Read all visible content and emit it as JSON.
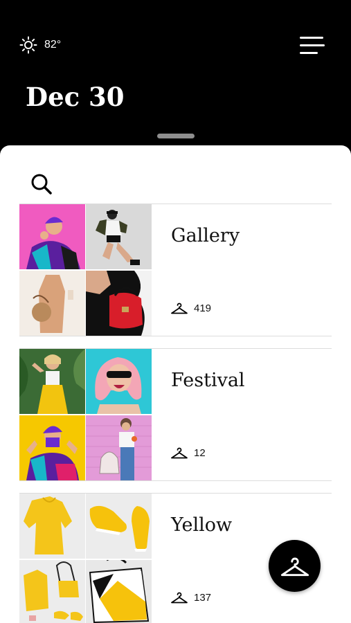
{
  "header": {
    "weather": {
      "icon": "sun-icon",
      "temperature": "82°"
    },
    "date": "Dec 30",
    "menu_icon": "hamburger-menu-icon"
  },
  "search": {
    "icon": "search-icon"
  },
  "collections": [
    {
      "title": "Gallery",
      "count": "419",
      "count_icon": "hanger-icon",
      "tile_colors": [
        "#f05bc0",
        "#d9d9d9",
        "#f3ede6",
        "#101010"
      ]
    },
    {
      "title": "Festival",
      "count": "12",
      "count_icon": "hanger-icon",
      "tile_colors": [
        "#3b6b35",
        "#2ec7d6",
        "#f6c800",
        "#e39bd8"
      ]
    },
    {
      "title": "Yellow",
      "count": "137",
      "count_icon": "hanger-icon",
      "tile_colors": [
        "#ececec",
        "#ececec",
        "#ececec",
        "#e8e8e8"
      ]
    }
  ],
  "fab": {
    "icon": "hanger-icon"
  }
}
